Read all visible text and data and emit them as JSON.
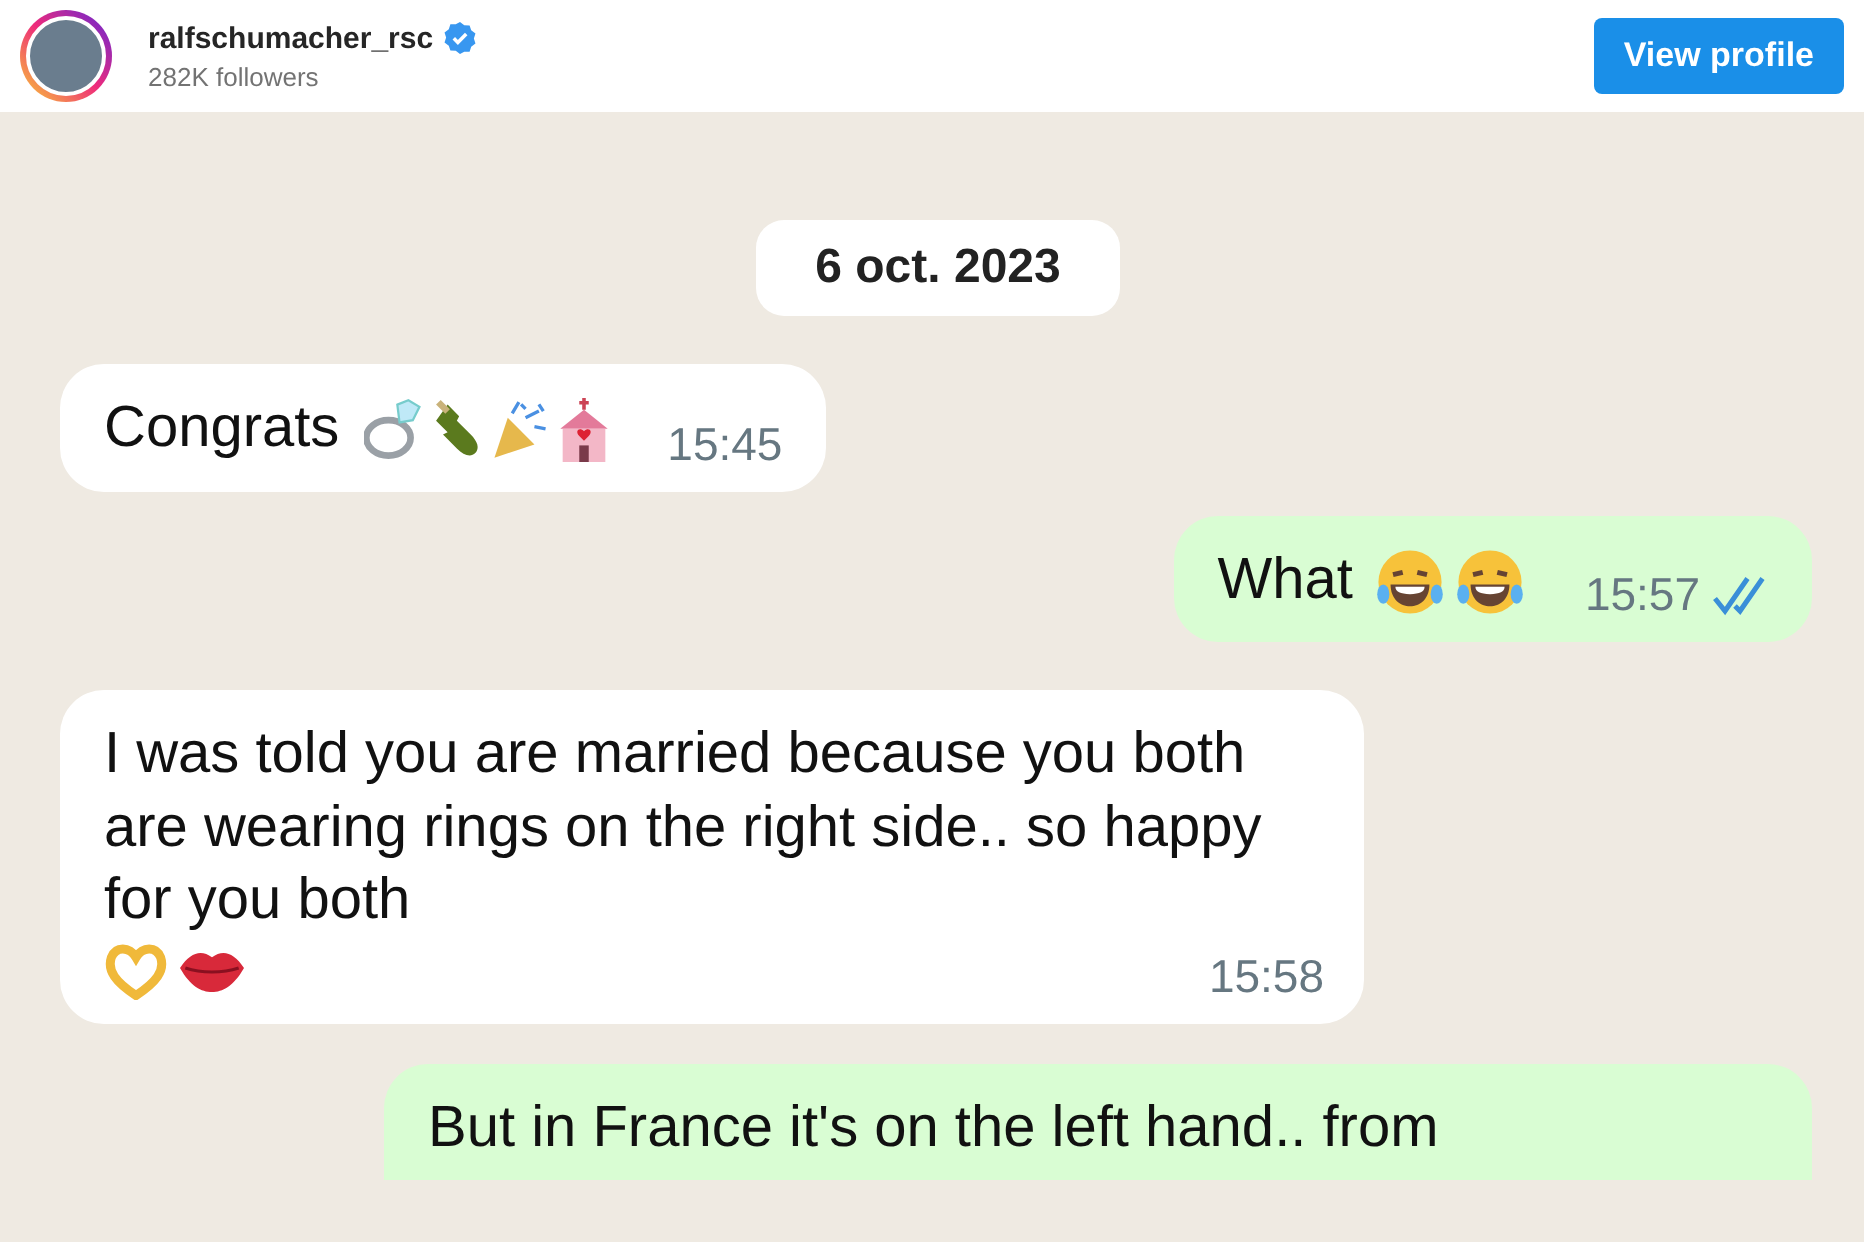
{
  "profile": {
    "username": "ralfschumacher_rsc",
    "verified": true,
    "followers": "282K followers",
    "button": "View profile"
  },
  "chat": {
    "date": "6 oct. 2023",
    "messages": [
      {
        "outgoing": false,
        "text": "Congrats",
        "time": "15:45"
      },
      {
        "outgoing": true,
        "text": "What",
        "time": "15:57",
        "read": true
      },
      {
        "outgoing": false,
        "text": "I was told you are married because you both are wearing rings on the right side.. so happy for you both",
        "time": "15:58"
      },
      {
        "outgoing": true,
        "text": "But in France it's on the left hand.. from"
      }
    ]
  }
}
